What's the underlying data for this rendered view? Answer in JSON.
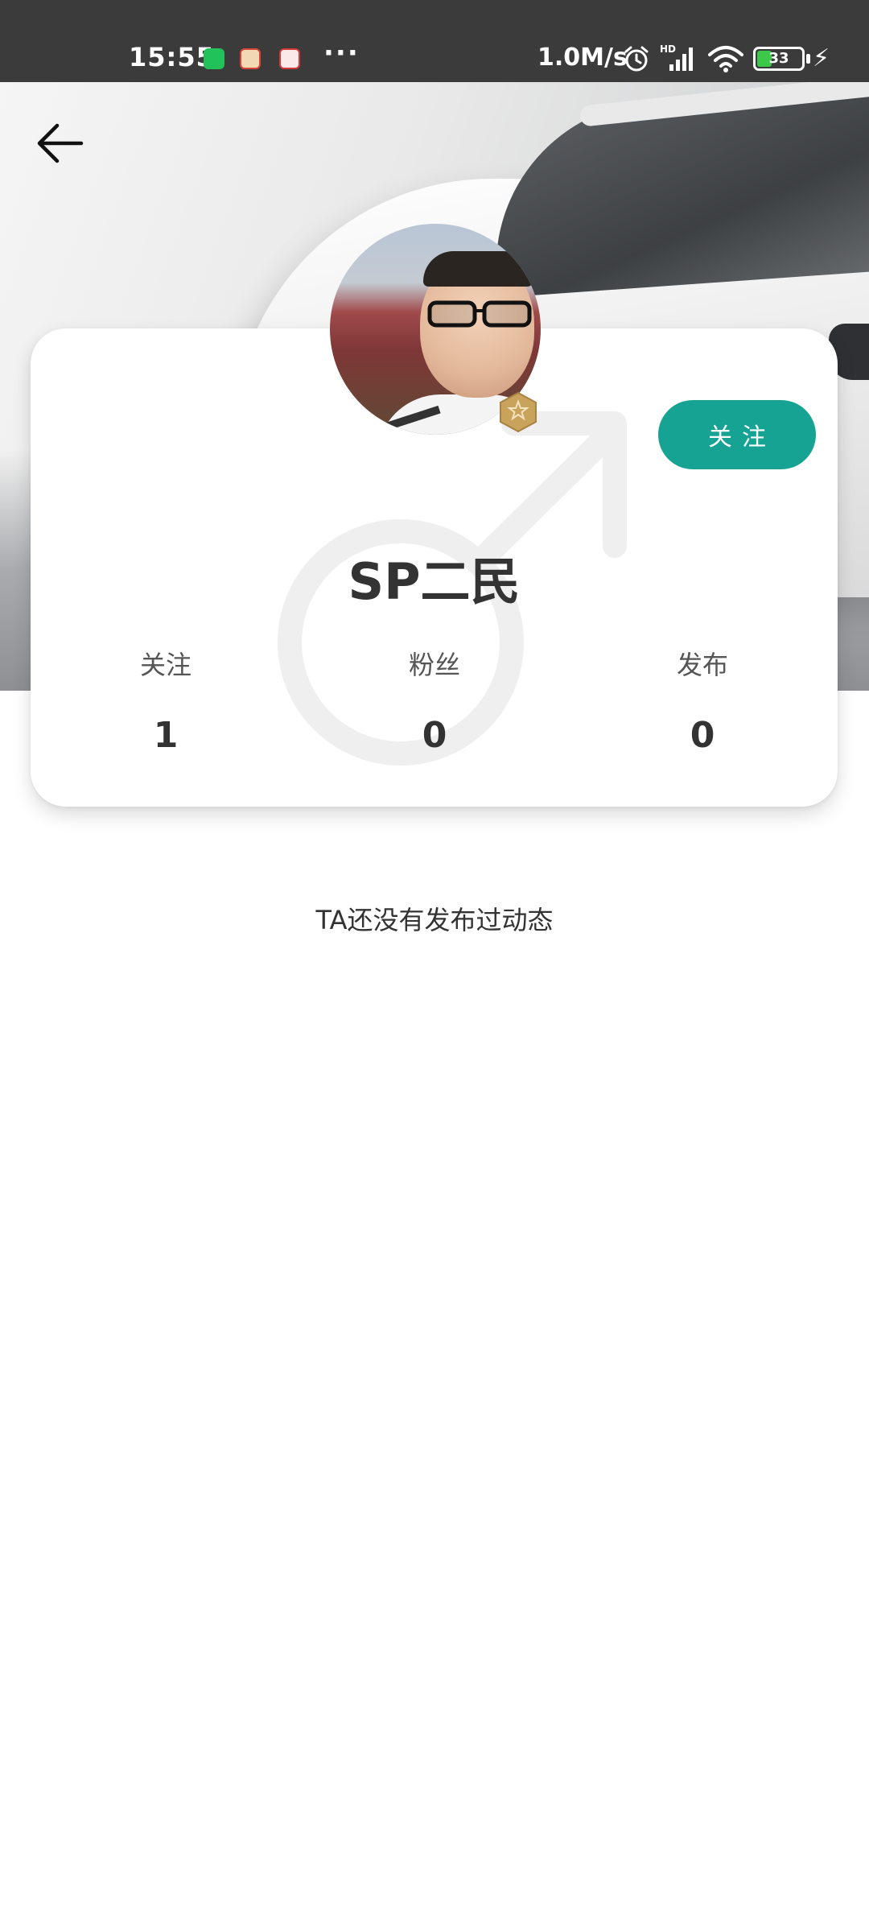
{
  "status_bar": {
    "time": "15:55",
    "more": "···",
    "speed": "1.0M/s",
    "network_label": "HD",
    "battery_level": 33,
    "battery_text": "33",
    "charging_symbol": "⚡"
  },
  "colors": {
    "accent": "#16a393",
    "status_bar_bg": "#3b3b3b",
    "battery_fill": "#3cc94a"
  },
  "nav": {
    "back_icon": "arrow-left-icon"
  },
  "profile": {
    "username": "SP二民",
    "gender_icon": "male-symbol-icon",
    "badge_icon": "hexagon-star-badge-icon",
    "follow_label": "关注",
    "stats": [
      {
        "label": "关注",
        "value": "1"
      },
      {
        "label": "粉丝",
        "value": "0"
      },
      {
        "label": "发布",
        "value": "0"
      }
    ]
  },
  "feed": {
    "empty_message": "TA还没有发布过动态"
  }
}
